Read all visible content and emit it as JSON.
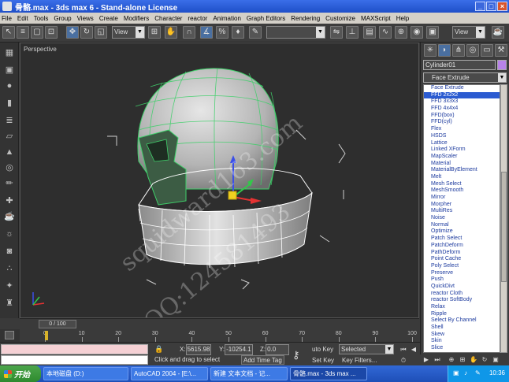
{
  "window": {
    "title": "骨骼.max - 3ds max 6 - Stand-alone License",
    "min_label": "_",
    "max_label": "□",
    "close_label": "×"
  },
  "menu": [
    "File",
    "Edit",
    "Tools",
    "Group",
    "Views",
    "Create",
    "Modifiers",
    "Character",
    "reactor",
    "Animation",
    "Graph Editors",
    "Rendering",
    "Customize",
    "MAXScript",
    "Help"
  ],
  "toolbar": {
    "view_select": "View",
    "named_selection": "",
    "view_select_right": "View"
  },
  "viewport": {
    "label": "Perspective",
    "watermark_1": "squidward163.com",
    "watermark_2": "QQ:124581493"
  },
  "command_panel": {
    "object_name": "Cylinder01",
    "object_color": "#b883e8",
    "modifier_list_label": "Face Extrude",
    "modifiers": [
      "Face Extrude",
      "FFD 2x2x2",
      "FFD 3x3x3",
      "FFD 4x4x4",
      "FFD(box)",
      "FFD(cyl)",
      "Flex",
      "HSDS",
      "Lattice",
      "Linked XForm",
      "MapScaler",
      "Material",
      "MaterialByElement",
      "Melt",
      "Mesh Select",
      "MeshSmooth",
      "Mirror",
      "Morpher",
      "MultiRes",
      "Noise",
      "Normal",
      "Optimize",
      "Patch Select",
      "PatchDeform",
      "PathDeform",
      "Point Cache",
      "Poly Select",
      "Preserve",
      "Push",
      "QuickDivt",
      "reactor Cloth",
      "reactor SoftBody",
      "Relax",
      "Ripple",
      "Select By Channel",
      "Shell",
      "Skew",
      "Skin",
      "Slice"
    ],
    "selected_modifier": "FFD 2x2x2"
  },
  "timeline": {
    "frame_display": "0 / 100",
    "ruler": [
      "0",
      "10",
      "20",
      "30",
      "40",
      "50",
      "60",
      "70",
      "80",
      "90",
      "100"
    ]
  },
  "status": {
    "x_label": "X:",
    "x_value": "5615.98",
    "y_label": "Y:",
    "y_value": "-10254.1",
    "z_label": "Z:",
    "z_value": "0.0",
    "prompt": "Click and drag to select",
    "add_time_tag": "Add Time Tag",
    "auto_key": "uto Key",
    "set_key": "Set Key",
    "selection_set": "Selected",
    "key_filters": "Key Filters..."
  },
  "taskbar": {
    "start_label": "开始",
    "tasks": [
      "本地磁盘 (D:)",
      "AutoCAD 2004 - [E:\\...",
      "新建 文本文档 - 记...",
      "骨骼.max - 3ds max ..."
    ],
    "active_task_index": 3,
    "clock": "10:36"
  },
  "colors": {
    "title_bar": "#2a5fd6",
    "viewport_bg": "#2e2e2e",
    "wireframe": "#3fd06a",
    "selected_item": "#2b5bd1",
    "list_text": "#1c3a9e"
  }
}
